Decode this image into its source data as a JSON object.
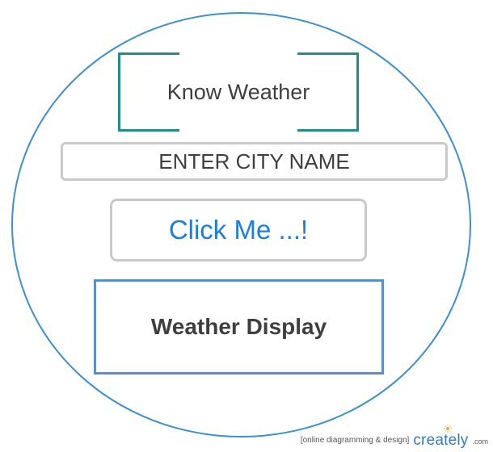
{
  "title": {
    "text": "Know Weather"
  },
  "city_input": {
    "placeholder": "ENTER CITY NAME"
  },
  "submit_button": {
    "label": "Click Me ...!"
  },
  "display": {
    "label": "Weather Display"
  },
  "watermark": {
    "tagline": "[online diagramming & design]",
    "brand": "creately",
    "suffix": ".com"
  },
  "colors": {
    "circle": "#3d8fd1",
    "title_brackets": "#1f8f87",
    "input_border": "#c9c9c9",
    "button_text": "#1b7fe0",
    "display_border": "#5b8fc9",
    "text": "#3f3f3f"
  }
}
